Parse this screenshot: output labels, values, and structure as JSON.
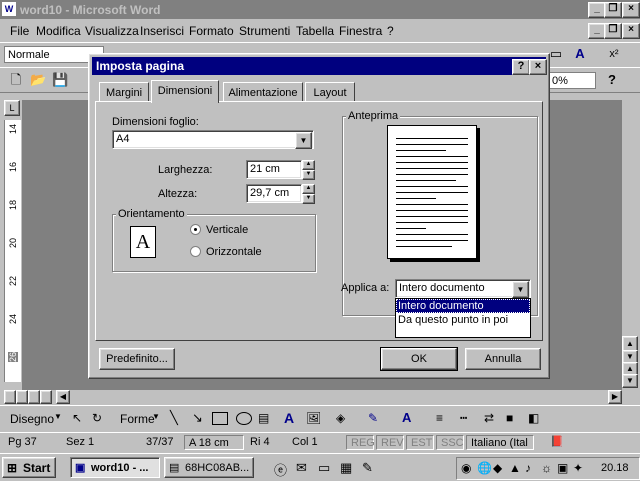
{
  "app": {
    "title": "word10 - Microsoft Word",
    "icon_label": "W",
    "window_buttons": [
      "_",
      "❐",
      "×"
    ],
    "doc_buttons": [
      "_",
      "❐",
      "×"
    ]
  },
  "menu": [
    "File",
    "Modifica",
    "Visualizza",
    "Inserisci",
    "Formato",
    "Strumenti",
    "Tabella",
    "Finestra",
    "?"
  ],
  "toolbar": {
    "style_value": "Normale",
    "zoom_value": "0%"
  },
  "ruler_numbers": [
    "14",
    "16",
    "18",
    "20",
    "22",
    "24",
    "26"
  ],
  "dialog": {
    "title": "Imposta pagina",
    "help_button": "?",
    "close_button": "×",
    "tabs": [
      "Margini",
      "Dimensioni",
      "Alimentazione",
      "Layout"
    ],
    "active_tab": "Dimensioni",
    "paper_size_label": "Dimensioni foglio:",
    "paper_size_value": "A4",
    "width_label": "Larghezza:",
    "width_value": "21 cm",
    "height_label": "Altezza:",
    "height_value": "29,7 cm",
    "orientation_label": "Orientamento",
    "orientation_icon": "A",
    "orientation_options": [
      "Verticale",
      "Orizzontale"
    ],
    "orientation_selected": "Verticale",
    "preview_label": "Anteprima",
    "apply_label": "Applica a:",
    "apply_value": "Intero documento",
    "apply_options": [
      "Intero documento",
      "Da questo punto in poi"
    ],
    "default_button": "Predefinito...",
    "ok_button": "OK",
    "cancel_button": "Annulla"
  },
  "drawing_toolbar": {
    "draw_label": "Disegno",
    "shapes_label": "Forme"
  },
  "statusbar": {
    "page": "Pg 37",
    "section": "Sez 1",
    "pages": "37/37",
    "at": "A  18 cm",
    "line": "Ri 4",
    "col": "Col 1",
    "rec": "REG",
    "rev": "REV",
    "ext": "EST",
    "ovr": "SSC",
    "language": "Italiano (Ital"
  },
  "taskbar": {
    "start": "Start",
    "tasks": [
      "word10 - ...",
      "68HC08AB..."
    ],
    "clock": "20.18"
  },
  "colors": {
    "dialog_title_bg": "#00007f",
    "inactive_title_bg": "#808080",
    "face": "#c0c0c0"
  }
}
